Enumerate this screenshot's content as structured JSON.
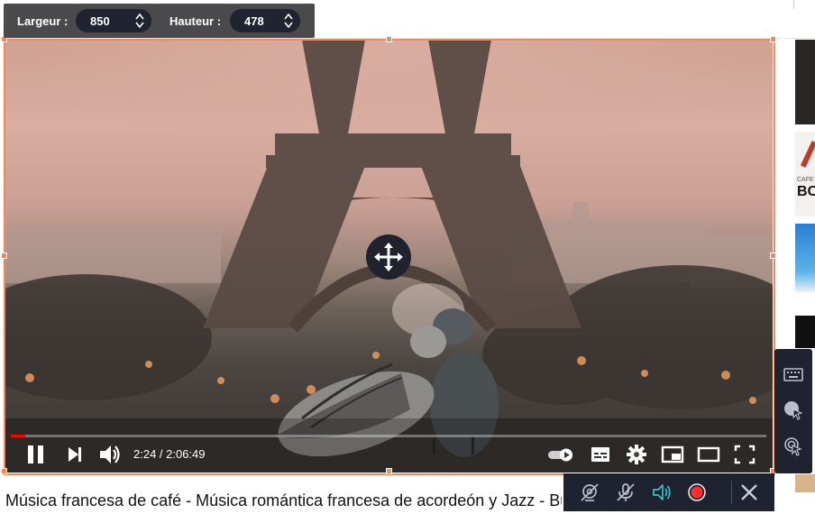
{
  "dimensions": {
    "width_label": "Largeur :",
    "width_value": "850",
    "height_label": "Hauteur :",
    "height_value": "478"
  },
  "player": {
    "time_display": "2:24 / 2:06:49",
    "progress_fraction": 0.019
  },
  "video_title": "Música francesa de café - Música romántica francesa de acordeón y Jazz - Bu",
  "sidebar_thumb_text": {
    "thumb2_line1": "CAFE",
    "thumb2_line2": "BO"
  },
  "colors": {
    "region_border": "#f08a5d",
    "panel_bg": "#1f2330",
    "record_red": "#ff2d2d",
    "speaker_teal": "#35c3c8",
    "progress_red": "#ff0000"
  },
  "icons": {
    "side_tools": [
      "keyboard-icon",
      "cursor-highlight-icon",
      "click-effect-icon"
    ],
    "rec_tools": [
      "webcam-off-icon",
      "mic-off-icon",
      "speaker-icon",
      "record-icon",
      "close-icon"
    ],
    "player_controls": [
      "pause-icon",
      "next-icon",
      "volume-icon",
      "autoplay-toggle-icon",
      "subtitles-icon",
      "settings-icon",
      "miniplayer-icon",
      "theater-icon",
      "fullscreen-icon"
    ]
  }
}
